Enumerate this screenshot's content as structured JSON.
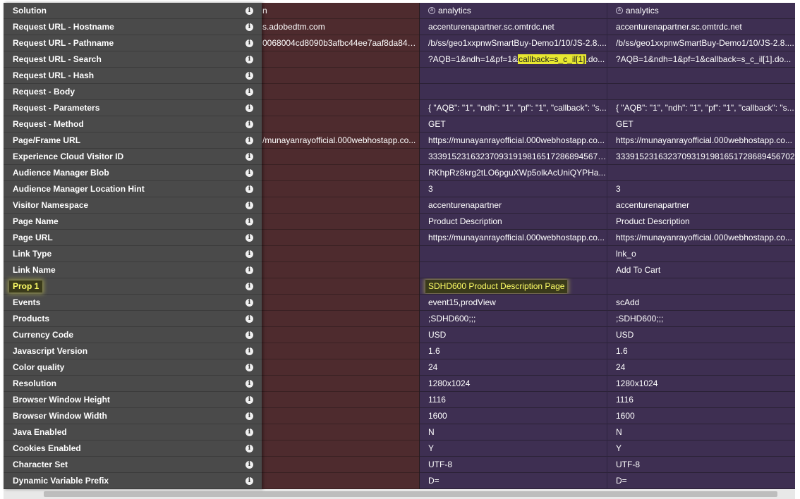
{
  "rows": [
    {
      "label": "Solution",
      "first": "n",
      "second": "analytics",
      "third": "analytics"
    },
    {
      "label": "Request URL - Hostname",
      "first": "s.adobedtm.com",
      "second": "accenturenapartner.sc.omtrdc.net",
      "third": "accenturenapartner.sc.omtrdc.net"
    },
    {
      "label": "Request URL - Pathname",
      "first": "0068004cd8090b3afbc44ee7aaf8da846...",
      "second": "/b/ss/geo1xxpnwSmartBuy-Demo1/10/JS-2.8....",
      "third": "/b/ss/geo1xxpnwSmartBuy-Demo1/10/JS-2.8...."
    },
    {
      "label": "Request URL - Search",
      "first": "",
      "second_pre": "?AQB=1&ndh=1&pf=1&",
      "second_hl": "callback=s_c_il[1]",
      "second_post": ".do...",
      "third": "?AQB=1&ndh=1&pf=1&callback=s_c_il[1].do..."
    },
    {
      "label": "Request URL - Hash",
      "first": "",
      "second": "",
      "third": ""
    },
    {
      "label": "Request - Body",
      "first": "",
      "second": "",
      "third": ""
    },
    {
      "label": "Request - Parameters",
      "first": "",
      "second": "{ \"AQB\": \"1\", \"ndh\": \"1\", \"pf\": \"1\", \"callback\": \"s...",
      "third": "{ \"AQB\": \"1\", \"ndh\": \"1\", \"pf\": \"1\", \"callback\": \"s..."
    },
    {
      "label": "Request - Method",
      "first": "",
      "second": "GET",
      "third": "GET"
    },
    {
      "label": "Page/Frame URL",
      "first": "/munayanrayofficial.000webhostapp.co...",
      "second": "https://munayanrayofficial.000webhostapp.co...",
      "third": "https://munayanrayofficial.000webhostapp.co..."
    },
    {
      "label": "Experience Cloud Visitor ID",
      "first": "",
      "second": "33391523163237093191981651728689456702",
      "third": "33391523163237093191981651728689456702"
    },
    {
      "label": "Audience Manager Blob",
      "first": "",
      "second": "RKhpRz8krg2tLO6pguXWp5olkAcUniQYPHa...",
      "third": ""
    },
    {
      "label": "Audience Manager Location Hint",
      "first": "",
      "second": "3",
      "third": "3"
    },
    {
      "label": "Visitor Namespace",
      "first": "",
      "second": "accenturenapartner",
      "third": "accenturenapartner"
    },
    {
      "label": "Page Name",
      "first": "",
      "second": "Product Description",
      "third": "Product Description"
    },
    {
      "label": "Page URL",
      "first": "",
      "second": "https://munayanrayofficial.000webhostapp.co...",
      "third": "https://munayanrayofficial.000webhostapp.co..."
    },
    {
      "label": "Link Type",
      "first": "",
      "second": "",
      "third": "lnk_o"
    },
    {
      "label": "Link Name",
      "first": "",
      "second": "",
      "third": "Add To Cart"
    },
    {
      "label": "Prop 1",
      "first": "",
      "second": "SDHD600 Product Description Page",
      "third": "",
      "highlight": true
    },
    {
      "label": "Events",
      "first": "",
      "second": "event15,prodView",
      "third": "scAdd"
    },
    {
      "label": "Products",
      "first": "",
      "second": ";SDHD600;;;",
      "third": ";SDHD600;;;"
    },
    {
      "label": "Currency Code",
      "first": "",
      "second": "USD",
      "third": "USD"
    },
    {
      "label": "Javascript Version",
      "first": "",
      "second": "1.6",
      "third": "1.6"
    },
    {
      "label": "Color quality",
      "first": "",
      "second": "24",
      "third": "24"
    },
    {
      "label": "Resolution",
      "first": "",
      "second": "1280x1024",
      "third": "1280x1024"
    },
    {
      "label": "Browser Window Height",
      "first": "",
      "second": "1116",
      "third": "1116"
    },
    {
      "label": "Browser Window Width",
      "first": "",
      "second": "1600",
      "third": "1600"
    },
    {
      "label": "Java Enabled",
      "first": "",
      "second": "N",
      "third": "N"
    },
    {
      "label": "Cookies Enabled",
      "first": "",
      "second": "Y",
      "third": "Y"
    },
    {
      "label": "Character Set",
      "first": "",
      "second": "UTF-8",
      "third": "UTF-8"
    },
    {
      "label": "Dynamic Variable Prefix",
      "first": "",
      "second": "D=",
      "third": "D="
    }
  ],
  "info_glyph": "i",
  "solution_glyph": "a",
  "colors": {
    "first_column_bg": "#4e2b2e",
    "data_column_bg": "#3e2f52",
    "left_panel_bg": "#4a4a4a",
    "highlight_yellow": "#ffff66"
  }
}
